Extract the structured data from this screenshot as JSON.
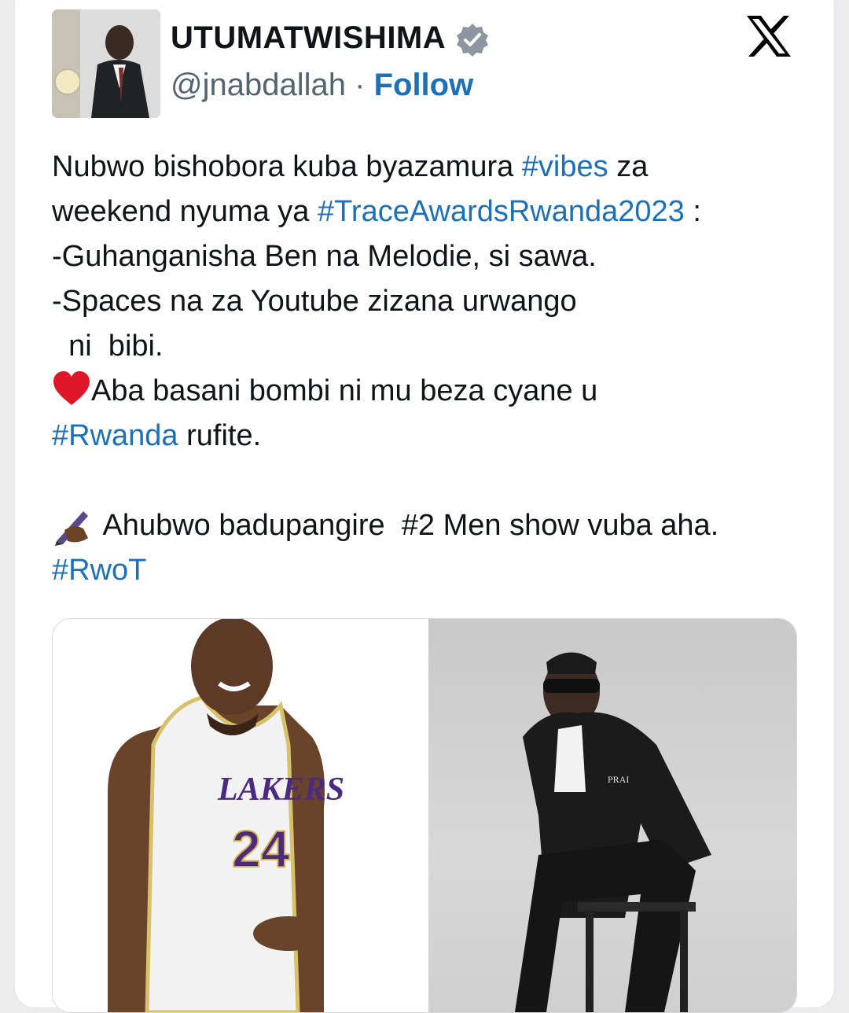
{
  "author": {
    "display_name": "UTUMATWISHIMA",
    "handle": "@jnabdallah",
    "separator": "·",
    "follow_label": "Follow",
    "verified": true,
    "verified_color": "#8d96a0"
  },
  "platform": {
    "logo_icon": "x-logo-icon"
  },
  "tweet": {
    "line1_a": "Nubwo bishobora kuba byazamura ",
    "line1_tag": "#vibes",
    "line1_b": " za",
    "line2_a": "weekend nyuma ya ",
    "line2_tag": "#TraceAwardsRwanda2023",
    "line2_b": " :",
    "line3": "-Guhanganisha Ben na Melodie, si sawa.",
    "line4": "-Spaces na za Youtube zizana urwango",
    "line5": "  ni  bibi.",
    "line6_emoji": "❤️",
    "line6": "Aba basani bombi ni mu beza cyane u",
    "line7_tag": "#Rwanda",
    "line7_b": " rufite.",
    "line8_emoji": "✍🏾",
    "line8": " Ahubwo badupangire  #2 Men show vuba aha.",
    "line9_tag": "#RwoT"
  },
  "media": {
    "jersey_brand": "LAKERS",
    "jersey_number": "24",
    "jacket_label": "PRAI"
  },
  "colors": {
    "link": "#1d6fb8",
    "text": "#0f1419",
    "muted": "#536471",
    "heart": "#e0162b"
  }
}
